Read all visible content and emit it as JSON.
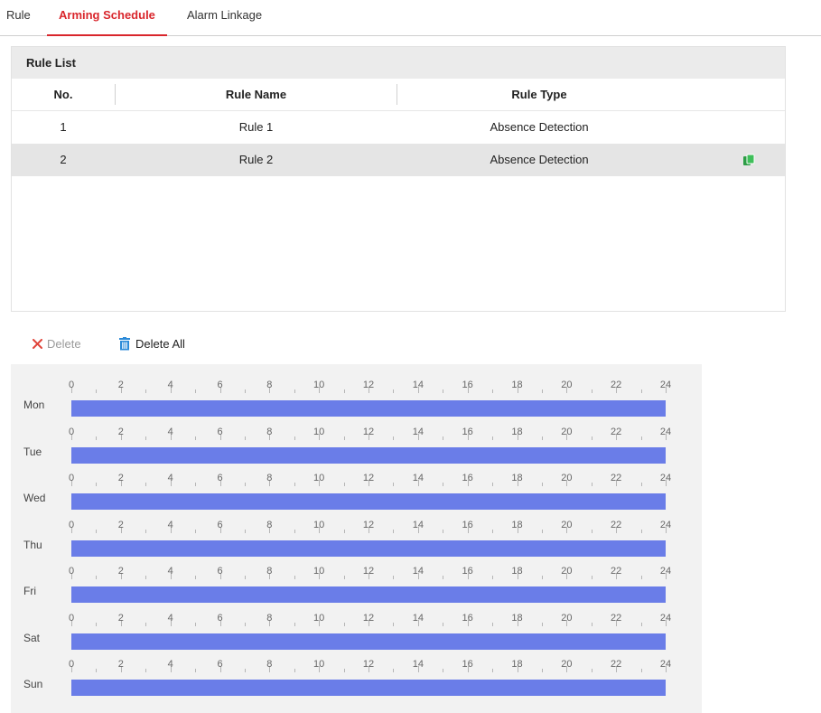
{
  "tabs": [
    {
      "label": "Rule",
      "active": false
    },
    {
      "label": "Arming Schedule",
      "active": true
    },
    {
      "label": "Alarm Linkage",
      "active": false
    }
  ],
  "accent_color": "#d9262c",
  "rule_list": {
    "title": "Rule List",
    "columns": [
      "No.",
      "Rule Name",
      "Rule Type"
    ],
    "rows": [
      {
        "no": "1",
        "name": "Rule 1",
        "type": "Absence Detection",
        "selected": false
      },
      {
        "no": "2",
        "name": "Rule 2",
        "type": "Absence Detection",
        "selected": true,
        "action_icon": "copy-icon"
      }
    ]
  },
  "toolbar": {
    "delete_label": "Delete",
    "delete_all_label": "Delete All"
  },
  "schedule": {
    "bar_color": "#6a7de8",
    "hour_labels": [
      "0",
      "2",
      "4",
      "6",
      "8",
      "10",
      "12",
      "14",
      "16",
      "18",
      "20",
      "22",
      "24"
    ],
    "days": [
      {
        "label": "Mon",
        "start": 0,
        "end": 24
      },
      {
        "label": "Tue",
        "start": 0,
        "end": 24
      },
      {
        "label": "Wed",
        "start": 0,
        "end": 24
      },
      {
        "label": "Thu",
        "start": 0,
        "end": 24
      },
      {
        "label": "Fri",
        "start": 0,
        "end": 24
      },
      {
        "label": "Sat",
        "start": 0,
        "end": 24
      },
      {
        "label": "Sun",
        "start": 0,
        "end": 24
      }
    ]
  }
}
